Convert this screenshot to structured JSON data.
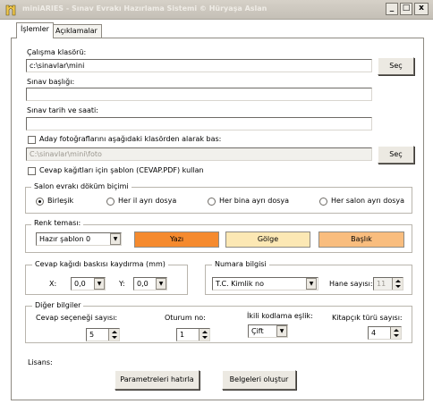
{
  "window": {
    "title": "miniARIES - Sınav Evrakı Hazırlama Sistemi  © Hüryaşa Aslan",
    "minimize": "_",
    "maximize": "□",
    "close": "x"
  },
  "tabs": [
    {
      "label": "İşlemler",
      "active": true
    },
    {
      "label": "Açıklamalar",
      "active": false
    }
  ],
  "form": {
    "folder_label": "Çalışma klasörü:",
    "folder_value": "c:\\sinavlar\\mini",
    "folder_button": "Seç",
    "title_label": "Sınav başlığı:",
    "title_value": "",
    "datetime_label": "Sınav tarih ve saati:",
    "datetime_value": "",
    "photo_checkbox": "Aday fotoğraflarını aşağıdaki klasörden alarak bas:",
    "photo_checked": false,
    "photo_folder": "C:\\sinavlar\\mini\\foto",
    "photo_button": "Seç",
    "template_checkbox": "Cevap kağıtları  için şablon (CEVAP.PDF) kullan",
    "template_checked": false
  },
  "salon": {
    "title": "Salon evrakı döküm biçimi",
    "options": [
      {
        "label": "Birleşik",
        "selected": true
      },
      {
        "label": "Her il ayrı dosya",
        "selected": false
      },
      {
        "label": "Her bina ayrı dosya",
        "selected": false
      },
      {
        "label": "Her salon ayrı dosya",
        "selected": false
      }
    ]
  },
  "theme": {
    "title": "Renk teması:",
    "selected": "Hazır şablon 0",
    "buttons": [
      {
        "label": "Yazı",
        "color": "#f58a2e"
      },
      {
        "label": "Gölge",
        "color": "#fce8b4"
      },
      {
        "label": "Başlık",
        "color": "#f9bd7e"
      }
    ]
  },
  "offset": {
    "title": "Cevap kağıdı baskısı kaydırma (mm)",
    "x_label": "X:",
    "x_value": "0,0",
    "y_label": "Y:",
    "y_value": "0,0"
  },
  "number": {
    "title": "Numara bilgisi",
    "selected": "T.C. Kimlik no",
    "digits_label": "Hane sayısı:",
    "digits_value": "11"
  },
  "other": {
    "title": "Diğer bilgiler",
    "options_label": "Cevap seçeneği sayısı:",
    "options_value": "5",
    "session_label": "Oturum no:",
    "session_value": "1",
    "binary_label": "İkili kodlama eşlik:",
    "binary_value": "Çift",
    "booklet_label": "Kitapçık türü sayısı:",
    "booklet_value": "4"
  },
  "license_label": "Lisans:",
  "actions": {
    "remember": "Parametreleri  hatırla",
    "generate": "Belgeleri oluştur"
  }
}
